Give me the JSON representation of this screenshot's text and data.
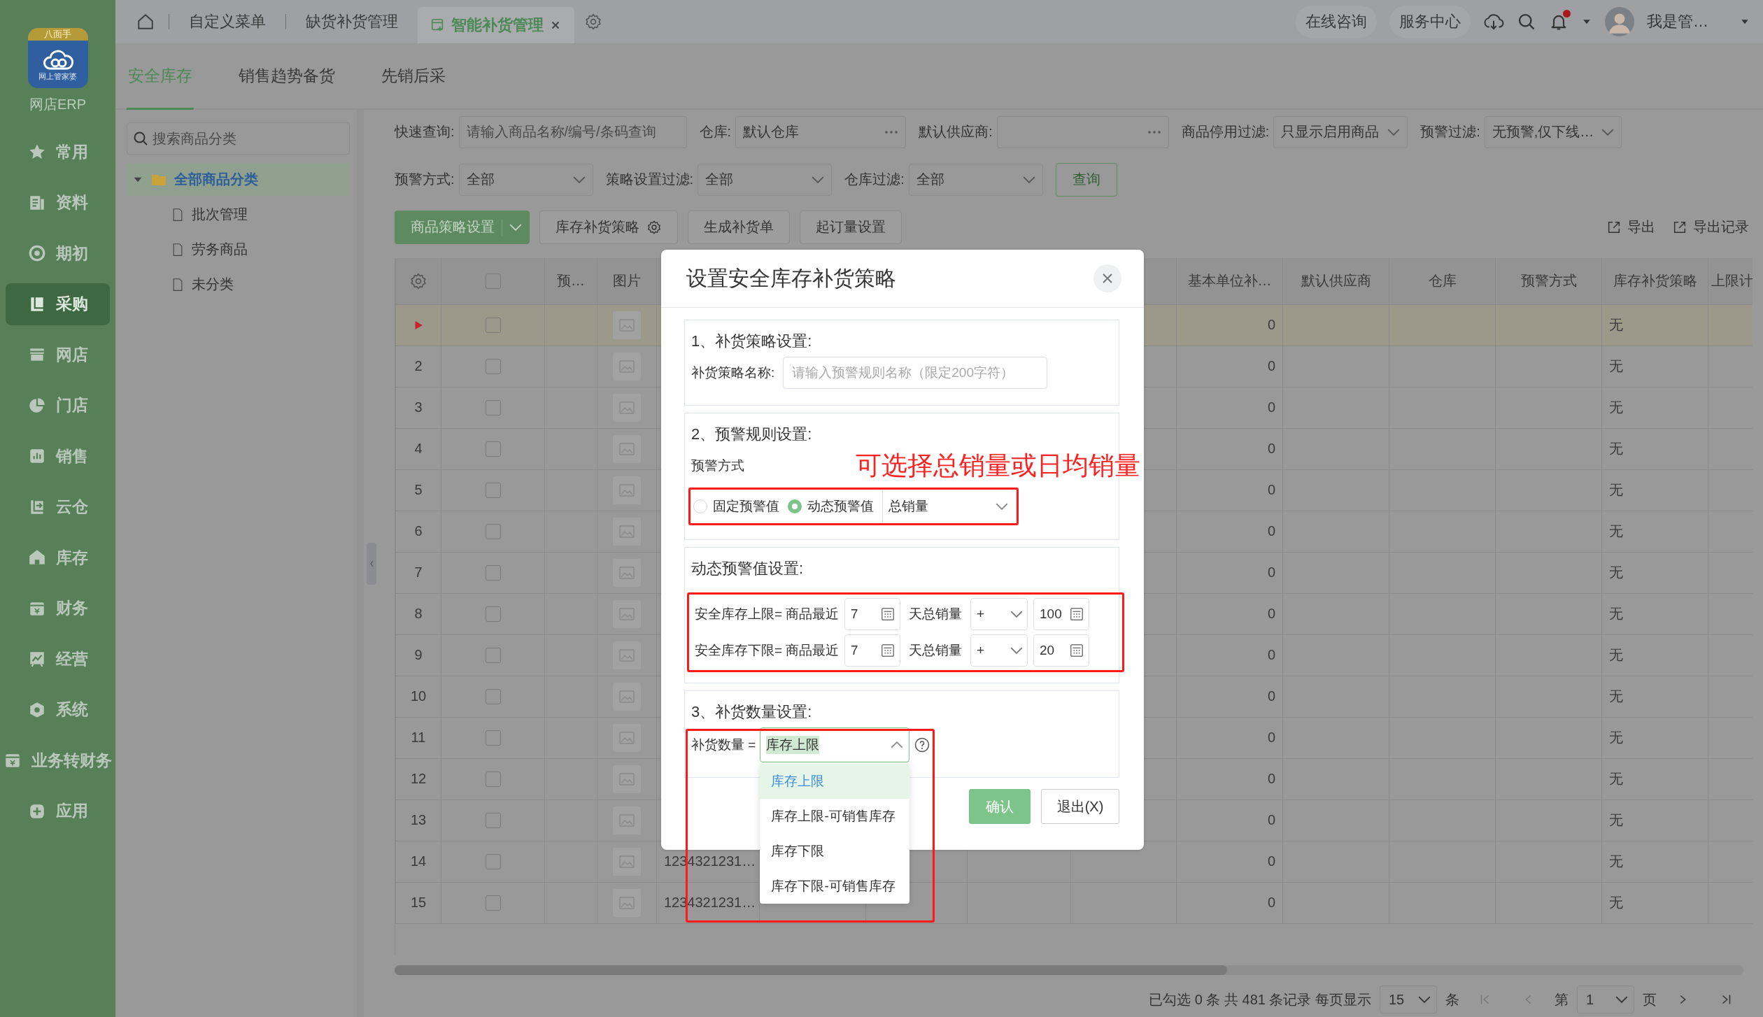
{
  "app": {
    "logo_badge": "八面手",
    "logo_caption": "网上管家婆",
    "name": "网店ERP"
  },
  "sidebar": {
    "items": [
      {
        "label": "常用",
        "selected": false
      },
      {
        "label": "资料",
        "selected": false
      },
      {
        "label": "期初",
        "selected": false
      },
      {
        "label": "采购",
        "selected": true
      },
      {
        "label": "网店",
        "selected": false
      },
      {
        "label": "门店",
        "selected": false
      },
      {
        "label": "销售",
        "selected": false
      },
      {
        "label": "云仓",
        "selected": false
      },
      {
        "label": "库存",
        "selected": false
      },
      {
        "label": "财务",
        "selected": false
      },
      {
        "label": "经营",
        "selected": false
      },
      {
        "label": "系统",
        "selected": false
      },
      {
        "label": "业务转财务",
        "selected": false
      },
      {
        "label": "应用",
        "selected": false
      }
    ]
  },
  "top_tabs": [
    {
      "label": "自定义菜单",
      "selected": false
    },
    {
      "label": "缺货补货管理",
      "selected": false
    },
    {
      "label": "智能补货管理",
      "selected": true
    }
  ],
  "top_actions": {
    "buttons": [
      "在线咨询",
      "服务中心"
    ],
    "notification_dot": true,
    "user": "我是管…"
  },
  "sub_tabs": [
    {
      "label": "安全库存",
      "selected": true
    },
    {
      "label": "销售趋势备货",
      "selected": false
    },
    {
      "label": "先销后采",
      "selected": false
    }
  ],
  "category_tree": {
    "search_placeholder": "搜索商品分类",
    "items": [
      {
        "label": "全部商品分类",
        "selected": true,
        "expanded": true,
        "children": [
          {
            "label": "批次管理",
            "selected": false
          },
          {
            "label": "劳务商品",
            "selected": false
          },
          {
            "label": "未分类",
            "selected": false
          }
        ]
      }
    ]
  },
  "filter_rows": [
    {
      "fields": [
        {
          "kind": "text",
          "label": "快速查询:",
          "placeholder": "请输入商品名称/编号/条码查询"
        },
        {
          "kind": "picker",
          "label": "仓库:",
          "value": "默认仓库"
        },
        {
          "kind": "picker",
          "label": "默认供应商:"
        },
        {
          "kind": "select",
          "label": "商品停用过滤:",
          "value": "只显示启用商品"
        },
        {
          "kind": "select",
          "label": "预警过滤:",
          "value": "无预警,仅下线…"
        }
      ]
    },
    {
      "fields": [
        {
          "kind": "select",
          "label": "预警方式:",
          "value": "全部"
        },
        {
          "kind": "select",
          "label": "策略设置过滤:",
          "value": "全部"
        },
        {
          "kind": "select",
          "label": "仓库过滤:",
          "value": "全部"
        }
      ],
      "button": "查询"
    }
  ],
  "toolbar": {
    "buttons": [
      {
        "kind": "split",
        "label": "商品策略设置"
      },
      {
        "kind": "gear",
        "label": "库存补货策略"
      },
      {
        "kind": "plain",
        "label": "生成补货单"
      },
      {
        "kind": "plain",
        "label": "起订量设置"
      }
    ],
    "links": [
      "导出",
      "导出记录"
    ]
  },
  "table": {
    "columns": [
      {
        "kind": "settings"
      },
      {
        "kind": "checkbox",
        "checked": false
      },
      {
        "kind": "text",
        "label": "预…"
      },
      {
        "kind": "text",
        "label": "图片"
      },
      {
        "kind": "blank"
      },
      {
        "kind": "blank"
      },
      {
        "kind": "blank"
      },
      {
        "kind": "blank"
      },
      {
        "kind": "blank"
      },
      {
        "kind": "text",
        "label": "基本单位补…"
      },
      {
        "kind": "text",
        "label": "默认供应商"
      },
      {
        "kind": "text",
        "label": "仓库"
      },
      {
        "kind": "text",
        "label": "预警方式"
      },
      {
        "kind": "text",
        "label": "库存补货策略"
      },
      {
        "kind": "text",
        "label": "上限计"
      }
    ],
    "rows": [
      {
        "selected": true,
        "checked": false,
        "base_unit_qty": "0",
        "strategy": "无"
      },
      {
        "number": "2",
        "selected": false,
        "checked": false,
        "base_unit_qty": "0",
        "strategy": "无"
      },
      {
        "number": "3",
        "selected": false,
        "checked": false,
        "base_unit_qty": "0",
        "strategy": "无"
      },
      {
        "number": "4",
        "selected": false,
        "checked": false,
        "base_unit_qty": "0",
        "strategy": "无"
      },
      {
        "number": "5",
        "selected": false,
        "checked": false,
        "base_unit_qty": "0",
        "strategy": "无"
      },
      {
        "number": "6",
        "selected": false,
        "checked": false,
        "base_unit_qty": "0",
        "strategy": "无"
      },
      {
        "number": "7",
        "selected": false,
        "checked": false,
        "base_unit_qty": "0",
        "strategy": "无"
      },
      {
        "number": "8",
        "selected": false,
        "checked": false,
        "base_unit_qty": "0",
        "strategy": "无"
      },
      {
        "number": "9",
        "selected": false,
        "checked": false,
        "base_unit_qty": "0",
        "strategy": "无"
      },
      {
        "number": "10",
        "selected": false,
        "checked": false,
        "base_unit_qty": "0",
        "strategy": "无"
      },
      {
        "number": "11",
        "selected": false,
        "checked": false,
        "base_unit_qty": "0",
        "strategy": "无"
      },
      {
        "number": "12",
        "selected": false,
        "checked": false,
        "base_unit_qty": "0",
        "strategy": "无"
      },
      {
        "number": "13",
        "selected": false,
        "checked": false,
        "base_unit_qty": "0",
        "strategy": "无"
      },
      {
        "number": "14",
        "selected": false,
        "checked": false,
        "code": "1234321231…",
        "base_unit_qty": "0",
        "strategy": "无"
      },
      {
        "number": "15",
        "selected": false,
        "checked": false,
        "code": "1234321231…",
        "base_unit_qty": "0",
        "strategy": "无"
      }
    ]
  },
  "pagination": {
    "summary": "已勾选 0 条 共 481 条记录 每页显示",
    "page_size": "15",
    "size_unit": "条",
    "page_prefix": "第",
    "page": "1",
    "page_suffix": "页"
  },
  "dialog": {
    "title": "设置安全库存补货策略",
    "sections": [
      {
        "kind": "name",
        "title": "1、补货策略设置:",
        "label": "补货策略名称:",
        "placeholder": "请输入预警规则名称（限定200字符）"
      },
      {
        "kind": "warning",
        "title": "2、预警规则设置:",
        "label": "预警方式",
        "annotation": "可选择总销量或日均销量",
        "options": [
          {
            "label": "固定预警值",
            "selected": false
          },
          {
            "label": "动态预警值",
            "selected": true
          }
        ],
        "basis": "总销量"
      },
      {
        "kind": "dynamic",
        "title": "动态预警值设置:",
        "rows": [
          {
            "label": "安全库存上限= 商品最近",
            "days": "7",
            "unit": "天总销量",
            "operator": "+",
            "amount": "100"
          },
          {
            "label": "安全库存下限= 商品最近",
            "days": "7",
            "unit": "天总销量",
            "operator": "+",
            "amount": "20"
          }
        ]
      },
      {
        "kind": "quantity",
        "title": "3、补货数量设置:",
        "label": "补货数量 =",
        "value": "库存上限",
        "expanded": true,
        "options": [
          {
            "label": "库存上限",
            "selected": true
          },
          {
            "label": "库存上限-可销售库存",
            "selected": false
          },
          {
            "label": "库存下限",
            "selected": false
          },
          {
            "label": "库存下限-可销售库存",
            "selected": false
          }
        ]
      }
    ],
    "buttons": [
      {
        "kind": "primary",
        "label": "确认"
      },
      {
        "kind": "default",
        "label": "退出(X)"
      }
    ]
  }
}
